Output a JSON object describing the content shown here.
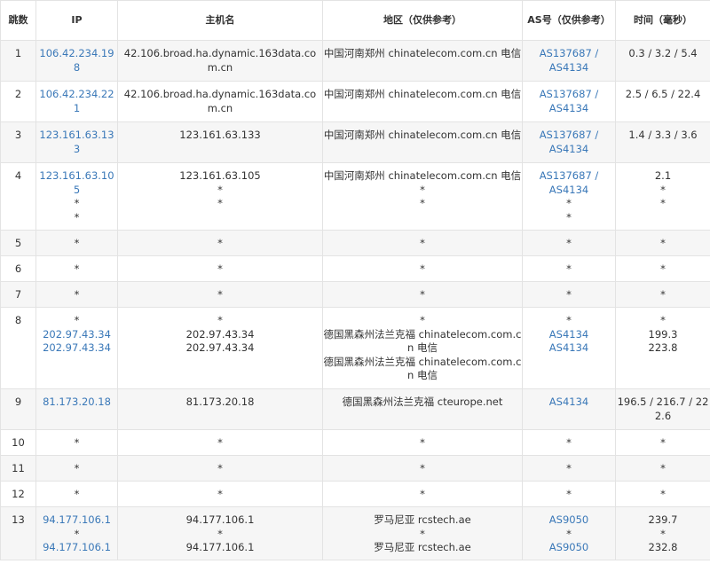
{
  "header": {
    "hop": "跳数",
    "ip": "IP",
    "host": "主机名",
    "region": "地区（仅供参考）",
    "as": "AS号（仅供参考）",
    "time": "时间（毫秒）"
  },
  "rows": [
    {
      "hop": "1",
      "ip": [
        "106.42.234.198"
      ],
      "host": [
        "42.106.broad.ha.dynamic.163data.com.cn"
      ],
      "region": [
        "中国河南郑州 chinatelecom.com.cn 电信"
      ],
      "as": [
        [
          "AS137687 /",
          "AS4134"
        ]
      ],
      "time": [
        "0.3 / 3.2 / 5.4"
      ]
    },
    {
      "hop": "2",
      "ip": [
        "106.42.234.221"
      ],
      "host": [
        "42.106.broad.ha.dynamic.163data.com.cn"
      ],
      "region": [
        "中国河南郑州 chinatelecom.com.cn 电信"
      ],
      "as": [
        [
          "AS137687 /",
          "AS4134"
        ]
      ],
      "time": [
        "2.5 / 6.5 / 22.4"
      ]
    },
    {
      "hop": "3",
      "ip": [
        "123.161.63.133"
      ],
      "host": [
        "123.161.63.133"
      ],
      "region": [
        "中国河南郑州 chinatelecom.com.cn 电信"
      ],
      "as": [
        [
          "AS137687 /",
          "AS4134"
        ]
      ],
      "time": [
        "1.4 / 3.3 / 3.6"
      ]
    },
    {
      "hop": "4",
      "ip": [
        "123.161.63.105",
        "*",
        "*"
      ],
      "host": [
        "123.161.63.105",
        "*",
        "*"
      ],
      "region": [
        "中国河南郑州 chinatelecom.com.cn 电信",
        "*",
        "*"
      ],
      "as": [
        [
          "AS137687 /",
          "AS4134"
        ],
        "*",
        "*"
      ],
      "time": [
        "2.1",
        "*",
        "*"
      ]
    },
    {
      "hop": "5",
      "ip": [
        "*"
      ],
      "host": [
        "*"
      ],
      "region": [
        "*"
      ],
      "as": [
        "*"
      ],
      "time": [
        "*"
      ]
    },
    {
      "hop": "6",
      "ip": [
        "*"
      ],
      "host": [
        "*"
      ],
      "region": [
        "*"
      ],
      "as": [
        "*"
      ],
      "time": [
        "*"
      ]
    },
    {
      "hop": "7",
      "ip": [
        "*"
      ],
      "host": [
        "*"
      ],
      "region": [
        "*"
      ],
      "as": [
        "*"
      ],
      "time": [
        "*"
      ]
    },
    {
      "hop": "8",
      "ip": [
        "*",
        "202.97.43.34",
        "202.97.43.34"
      ],
      "host": [
        "*",
        "202.97.43.34",
        "202.97.43.34"
      ],
      "region": [
        "*",
        "德国黑森州法兰克福 chinatelecom.com.cn 电信",
        "德国黑森州法兰克福 chinatelecom.com.cn 电信"
      ],
      "as": [
        "*",
        "AS4134",
        "AS4134"
      ],
      "time": [
        "*",
        "199.3",
        "223.8"
      ]
    },
    {
      "hop": "9",
      "ip": [
        "81.173.20.18"
      ],
      "host": [
        "81.173.20.18"
      ],
      "region": [
        "德国黑森州法兰克福 cteurope.net"
      ],
      "as": [
        "AS4134"
      ],
      "time": [
        "196.5 / 216.7 / 222.6"
      ]
    },
    {
      "hop": "10",
      "ip": [
        "*"
      ],
      "host": [
        "*"
      ],
      "region": [
        "*"
      ],
      "as": [
        "*"
      ],
      "time": [
        "*"
      ]
    },
    {
      "hop": "11",
      "ip": [
        "*"
      ],
      "host": [
        "*"
      ],
      "region": [
        "*"
      ],
      "as": [
        "*"
      ],
      "time": [
        "*"
      ]
    },
    {
      "hop": "12",
      "ip": [
        "*"
      ],
      "host": [
        "*"
      ],
      "region": [
        "*"
      ],
      "as": [
        "*"
      ],
      "time": [
        "*"
      ]
    },
    {
      "hop": "13",
      "ip": [
        "94.177.106.1",
        "*",
        "94.177.106.1"
      ],
      "host": [
        "94.177.106.1",
        "*",
        "94.177.106.1"
      ],
      "region": [
        "罗马尼亚 rcstech.ae",
        "*",
        "罗马尼亚 rcstech.ae"
      ],
      "as": [
        "AS9050",
        "*",
        "AS9050"
      ],
      "time": [
        "239.7",
        "*",
        "232.8"
      ]
    }
  ],
  "colors": {
    "link": "#3a78b8",
    "text": "#333333",
    "border": "#e3e3e3",
    "alt_row": "#f6f6f6"
  }
}
